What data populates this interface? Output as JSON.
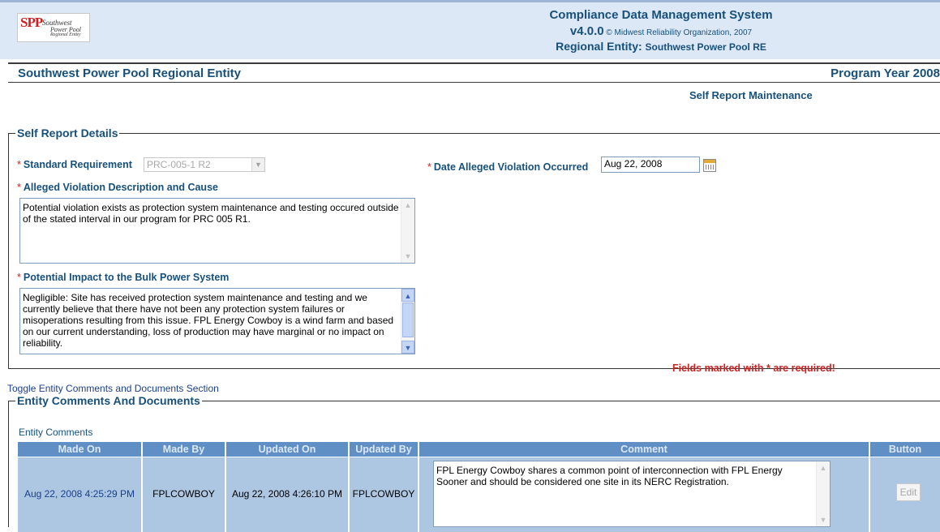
{
  "header": {
    "logo": {
      "mark": "SPP",
      "line1": "Southwest",
      "line2": "Power Pool",
      "line3": "Regional Entity"
    },
    "app_title": "Compliance Data Management System",
    "version": "v4.0.0",
    "copyright": "© Midwest Reliability Organization, 2007",
    "regional_entity_label": "Regional Entity:",
    "regional_entity_value": "Southwest Power Pool RE"
  },
  "title_bar": {
    "org_name": "Southwest Power Pool Regional Entity",
    "program_year": "Program Year 2008"
  },
  "page_subtitle": "Self Report Maintenance",
  "self_report": {
    "legend": "Self Report Details",
    "required_marker": "*",
    "standard_requirement_label": "Standard Requirement",
    "standard_requirement_value": "PRC-005-1 R2",
    "date_label": "Date Alleged Violation Occurred",
    "date_value": "Aug 22, 2008",
    "description_label": "Alleged Violation Description and Cause",
    "description_value": "Potential violation exists as protection system maintenance and testing occured outside of the stated interval in our program for PRC 005 R1.",
    "impact_label": "Potential Impact to the Bulk Power System",
    "impact_value": "Negligible: Site has received protection system maintenance and testing and we currently believe that there have not been any protection system failures or misoperations resulting from this issue.  FPL Energy Cowboy is a wind farm and based on our current understanding, loss of production may have marginal or no impact on reliability.",
    "required_note": "Fields marked with * are required!"
  },
  "toggle_link": "Toggle Entity Comments and Documents Section",
  "entity_section": {
    "legend": "Entity Comments And Documents",
    "comments_label": "Entity Comments",
    "columns": [
      "Made On",
      "Made By",
      "Updated On",
      "Updated By",
      "Comment",
      "Button"
    ],
    "rows": [
      {
        "made_on": "Aug 22, 2008 4:25:29 PM",
        "made_by": "FPLCOWBOY",
        "updated_on": "Aug 22, 2008 4:26:10 PM",
        "updated_by": "FPLCOWBOY",
        "comment": "FPL Energy Cowboy  shares a common point of interconnection with FPL Energy Sooner and should be considered one site in its NERC Registration.",
        "button": "Edit"
      }
    ]
  },
  "colors": {
    "header_bg": "#dce8f6",
    "title_blue": "#17507b",
    "required_red": "#cc2222",
    "table_header": "#5f8fc5",
    "table_cell": "#adc7e2",
    "link_blue": "#1a3f8e"
  },
  "icons": [
    "calendar-icon",
    "chevron-down-icon",
    "scroll-up-icon",
    "scroll-down-icon"
  ]
}
